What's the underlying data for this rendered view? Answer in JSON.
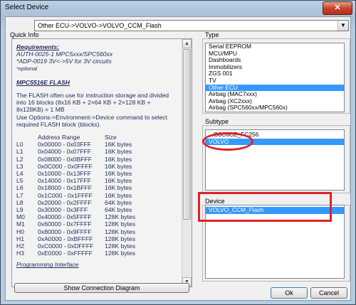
{
  "window": {
    "title": "Select Device",
    "close_label": "✕"
  },
  "device_combo": {
    "value": "Other ECU->VOLVO->VOLVO_CCM_Flash",
    "arrow": "▼"
  },
  "quick_info": {
    "label": "Quick Info",
    "requirements_heading": "Requirements:",
    "req_line1": "AUTH-0025-1 MPC5xxx/SPC560xx",
    "req_line2": "*ADP-0019 3V<->5V for 3V circuits",
    "req_line3": "*optional",
    "flash_heading": "MPC5516E FLASH",
    "para1": "The FLASH often use for instruction storage and divided into 16 blocks (8x16 KB + 2×64 KB + 2×128 KB + 8x128KB) = 1 MB",
    "para2": "Use Options->Environment->Device command to select required FLASH block (blocks).",
    "col_address": "Address Range",
    "col_size": "Size",
    "blocks": [
      [
        "L0",
        "0x00000 - 0x03FFF",
        "16K bytes"
      ],
      [
        "L1",
        "0x04000 - 0x07FFF",
        "16K bytes"
      ],
      [
        "L2",
        "0x08000 - 0x0BFFF",
        "16K bytes"
      ],
      [
        "L3",
        "0x0C000 - 0x0FFFF",
        "16K bytes"
      ],
      [
        "L4",
        "0x10000 - 0x13FFF",
        "16K bytes"
      ],
      [
        "L5",
        "0x14000 - 0x17FFF",
        "16K bytes"
      ],
      [
        "L6",
        "0x18000 - 0x1BFFF",
        "16K bytes"
      ],
      [
        "L7",
        "0x1C000 - 0x1FFFF",
        "16K bytes"
      ],
      [
        "L8",
        "0x20000 - 0x2FFFF",
        "64K bytes"
      ],
      [
        "L9",
        "0x30000 - 0x3FFF",
        "64K bytes"
      ],
      [
        "M0",
        "0x40000 - 0x5FFFF",
        "128K bytes"
      ],
      [
        "M1",
        "0x60000 - 0x7FFFF",
        "128K bytes"
      ],
      [
        "H0",
        "0x80000 - 0x9FFFF",
        "128K bytes"
      ],
      [
        "H1",
        "0xA0000 - 0xBFFFF",
        "128K bytes"
      ],
      [
        "H2",
        "0xC0000 - 0xDFFFF",
        "128K bytes"
      ],
      [
        "H3",
        "0xE0000 - 0xFFFFF",
        "128K bytes"
      ]
    ],
    "programming_interface": "Programming Interface"
  },
  "show_connection_button": "Show Connection Diagram",
  "type_group": {
    "label": "Type",
    "items": [
      "Serial EEPROM",
      "MCU/MPU",
      "Dashboards",
      "Immobilizers",
      "ZGS 001",
      "TV",
      "Other ECU",
      "Airbag (MAC7xxx)",
      "Airbag (XC2xxx)",
      "Airbag (SPC560xx/MPC560x)"
    ],
    "selected_index": 6
  },
  "subtype_group": {
    "label": "Subtype",
    "items": [
      "...G0C6CE_FC256",
      "VOLVO"
    ],
    "selected_index": 1
  },
  "device_group": {
    "label": "Device",
    "items": [
      "VOLVO_CCM_Flash"
    ],
    "selected_index": 0
  },
  "ok_button": "Ok",
  "cancel_button": "Cancel",
  "colors": {
    "selection": "#3399ff",
    "highlight_red": "#e0202a",
    "info_text": "#1f2b5c"
  }
}
